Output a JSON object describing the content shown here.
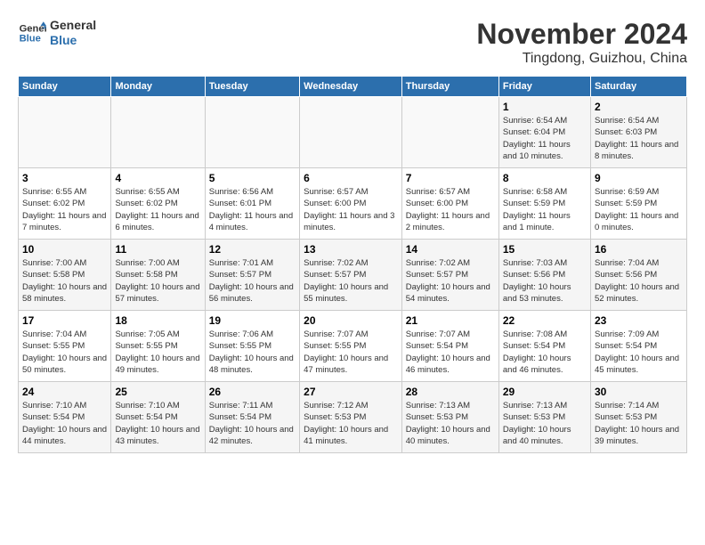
{
  "logo": {
    "line1": "General",
    "line2": "Blue"
  },
  "title": "November 2024",
  "subtitle": "Tingdong, Guizhou, China",
  "weekdays": [
    "Sunday",
    "Monday",
    "Tuesday",
    "Wednesday",
    "Thursday",
    "Friday",
    "Saturday"
  ],
  "weeks": [
    [
      {
        "day": "",
        "info": ""
      },
      {
        "day": "",
        "info": ""
      },
      {
        "day": "",
        "info": ""
      },
      {
        "day": "",
        "info": ""
      },
      {
        "day": "",
        "info": ""
      },
      {
        "day": "1",
        "info": "Sunrise: 6:54 AM\nSunset: 6:04 PM\nDaylight: 11 hours and 10 minutes."
      },
      {
        "day": "2",
        "info": "Sunrise: 6:54 AM\nSunset: 6:03 PM\nDaylight: 11 hours and 8 minutes."
      }
    ],
    [
      {
        "day": "3",
        "info": "Sunrise: 6:55 AM\nSunset: 6:02 PM\nDaylight: 11 hours and 7 minutes."
      },
      {
        "day": "4",
        "info": "Sunrise: 6:55 AM\nSunset: 6:02 PM\nDaylight: 11 hours and 6 minutes."
      },
      {
        "day": "5",
        "info": "Sunrise: 6:56 AM\nSunset: 6:01 PM\nDaylight: 11 hours and 4 minutes."
      },
      {
        "day": "6",
        "info": "Sunrise: 6:57 AM\nSunset: 6:00 PM\nDaylight: 11 hours and 3 minutes."
      },
      {
        "day": "7",
        "info": "Sunrise: 6:57 AM\nSunset: 6:00 PM\nDaylight: 11 hours and 2 minutes."
      },
      {
        "day": "8",
        "info": "Sunrise: 6:58 AM\nSunset: 5:59 PM\nDaylight: 11 hours and 1 minute."
      },
      {
        "day": "9",
        "info": "Sunrise: 6:59 AM\nSunset: 5:59 PM\nDaylight: 11 hours and 0 minutes."
      }
    ],
    [
      {
        "day": "10",
        "info": "Sunrise: 7:00 AM\nSunset: 5:58 PM\nDaylight: 10 hours and 58 minutes."
      },
      {
        "day": "11",
        "info": "Sunrise: 7:00 AM\nSunset: 5:58 PM\nDaylight: 10 hours and 57 minutes."
      },
      {
        "day": "12",
        "info": "Sunrise: 7:01 AM\nSunset: 5:57 PM\nDaylight: 10 hours and 56 minutes."
      },
      {
        "day": "13",
        "info": "Sunrise: 7:02 AM\nSunset: 5:57 PM\nDaylight: 10 hours and 55 minutes."
      },
      {
        "day": "14",
        "info": "Sunrise: 7:02 AM\nSunset: 5:57 PM\nDaylight: 10 hours and 54 minutes."
      },
      {
        "day": "15",
        "info": "Sunrise: 7:03 AM\nSunset: 5:56 PM\nDaylight: 10 hours and 53 minutes."
      },
      {
        "day": "16",
        "info": "Sunrise: 7:04 AM\nSunset: 5:56 PM\nDaylight: 10 hours and 52 minutes."
      }
    ],
    [
      {
        "day": "17",
        "info": "Sunrise: 7:04 AM\nSunset: 5:55 PM\nDaylight: 10 hours and 50 minutes."
      },
      {
        "day": "18",
        "info": "Sunrise: 7:05 AM\nSunset: 5:55 PM\nDaylight: 10 hours and 49 minutes."
      },
      {
        "day": "19",
        "info": "Sunrise: 7:06 AM\nSunset: 5:55 PM\nDaylight: 10 hours and 48 minutes."
      },
      {
        "day": "20",
        "info": "Sunrise: 7:07 AM\nSunset: 5:55 PM\nDaylight: 10 hours and 47 minutes."
      },
      {
        "day": "21",
        "info": "Sunrise: 7:07 AM\nSunset: 5:54 PM\nDaylight: 10 hours and 46 minutes."
      },
      {
        "day": "22",
        "info": "Sunrise: 7:08 AM\nSunset: 5:54 PM\nDaylight: 10 hours and 46 minutes."
      },
      {
        "day": "23",
        "info": "Sunrise: 7:09 AM\nSunset: 5:54 PM\nDaylight: 10 hours and 45 minutes."
      }
    ],
    [
      {
        "day": "24",
        "info": "Sunrise: 7:10 AM\nSunset: 5:54 PM\nDaylight: 10 hours and 44 minutes."
      },
      {
        "day": "25",
        "info": "Sunrise: 7:10 AM\nSunset: 5:54 PM\nDaylight: 10 hours and 43 minutes."
      },
      {
        "day": "26",
        "info": "Sunrise: 7:11 AM\nSunset: 5:54 PM\nDaylight: 10 hours and 42 minutes."
      },
      {
        "day": "27",
        "info": "Sunrise: 7:12 AM\nSunset: 5:53 PM\nDaylight: 10 hours and 41 minutes."
      },
      {
        "day": "28",
        "info": "Sunrise: 7:13 AM\nSunset: 5:53 PM\nDaylight: 10 hours and 40 minutes."
      },
      {
        "day": "29",
        "info": "Sunrise: 7:13 AM\nSunset: 5:53 PM\nDaylight: 10 hours and 40 minutes."
      },
      {
        "day": "30",
        "info": "Sunrise: 7:14 AM\nSunset: 5:53 PM\nDaylight: 10 hours and 39 minutes."
      }
    ]
  ]
}
